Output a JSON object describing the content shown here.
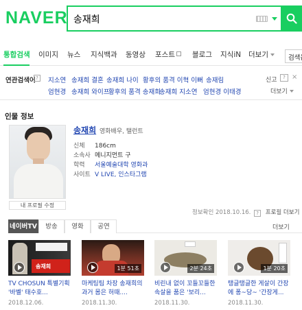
{
  "brand": {
    "logo": "NAVER",
    "accent": "#19ce60",
    "link_color": "#2146b1"
  },
  "search": {
    "value": "송재희"
  },
  "tabs": [
    {
      "label": "통합검색",
      "active": true
    },
    {
      "label": "이미지"
    },
    {
      "label": "뉴스"
    },
    {
      "label": "지식백과"
    },
    {
      "label": "동영상"
    },
    {
      "label": "포스트"
    },
    {
      "label": "블로그"
    },
    {
      "label": "지식iN"
    },
    {
      "label": "더보기"
    }
  ],
  "side_search_label": "검색옵",
  "related": {
    "title": "연관검색어",
    "help": "?",
    "report_label": "신고",
    "more_label": "더보기",
    "row1": [
      "지소연",
      "송재희 결혼",
      "송재희 나이",
      "황후의 품격 이혁 이뻐",
      "송재림"
    ],
    "row2": [
      "엄현경",
      "송재희 와이프",
      "황후의 품격 송재희",
      "송재희 지소연",
      "엄현경 이태경"
    ]
  },
  "person": {
    "section_title": "인물 정보",
    "photo_caption": "내 프로필 수정",
    "name": "송재희",
    "job": "영화배우, 탤런트",
    "height_label": "신체",
    "height": "186cm",
    "agency_label": "소속사",
    "agency": "메니지먼트 구",
    "school_label": "학력",
    "school": "서울예술대학 영화과",
    "site_label": "사이트",
    "sites": [
      "V LIVE",
      "인스타그램"
    ],
    "updated": "정보확인 2018.10.16.",
    "updated_help": "?",
    "profile_more": "프로필 더보기"
  },
  "video_tabs": [
    "네이버TV",
    "방송",
    "영화",
    "공연"
  ],
  "video_more": "더보기",
  "videos": [
    {
      "title": "TV CHOSUN 특별기획 '바벨' 태수호...",
      "date": "2018.12.06.",
      "overlay": "송재희"
    },
    {
      "title": "마케팅팀 차장 송재희의 과거 몸은 허때....",
      "date": "2018.11.30.",
      "duration": "1분 51초"
    },
    {
      "title": "비린내 없이 꼬들꼬들한 속살을 품은 '보리...",
      "date": "2018.11.30.",
      "duration": "2분 24초"
    },
    {
      "title": "탱글탱글한 게살이 간장에 퐁~당~ '간장게...",
      "date": "2018.11.30.",
      "duration": "1분 20초"
    }
  ]
}
